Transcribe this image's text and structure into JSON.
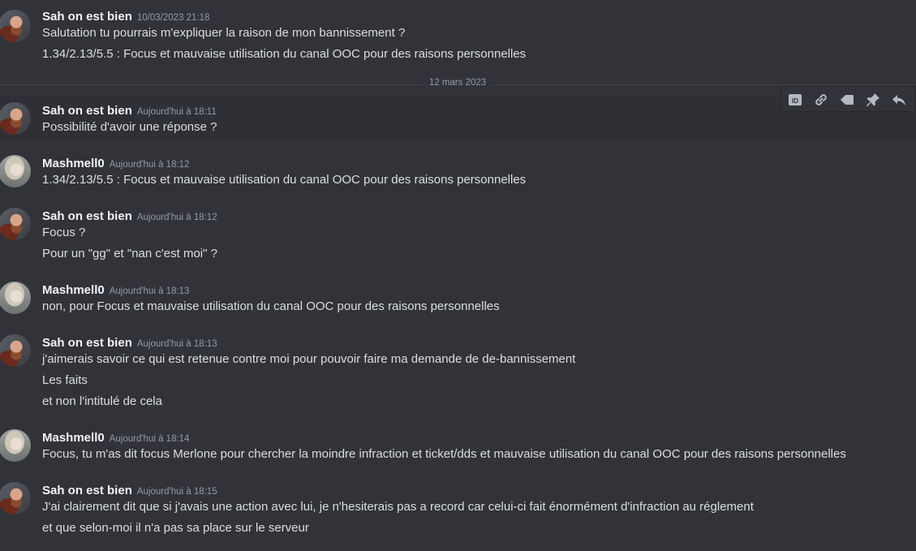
{
  "divider": {
    "date_label": "12 mars 2023"
  },
  "toolbar": {
    "buttons": [
      {
        "icon": "id-icon"
      },
      {
        "icon": "link-icon"
      },
      {
        "icon": "tag-icon"
      },
      {
        "icon": "pin-icon"
      },
      {
        "icon": "reply-icon"
      }
    ]
  },
  "messages": [
    {
      "author": "Sah on est bien",
      "avatar": "sah-avatar",
      "timestamp": "10/03/2023 21:18",
      "lines": [
        "Salutation tu pourrais m'expliquer la raison de mon bannissement ?",
        "1.34/2.13/5.5 : Focus et mauvaise utilisation du canal OOC pour des raisons personnelles"
      ]
    },
    {
      "author": "Sah on est bien",
      "avatar": "sah-avatar",
      "timestamp": "Aujourd'hui à 18:11",
      "lines": [
        "Possibilité d'avoir une réponse ?"
      ]
    },
    {
      "author": "Mashmell0",
      "avatar": "mashmell0-avatar",
      "timestamp": "Aujourd'hui à 18:12",
      "lines": [
        "1.34/2.13/5.5 : Focus et mauvaise utilisation du canal OOC pour des raisons personnelles"
      ]
    },
    {
      "author": "Sah on est bien",
      "avatar": "sah-avatar",
      "timestamp": "Aujourd'hui à 18:12",
      "lines": [
        "Focus ?",
        "Pour un \"gg\" et \"nan c'est moi\" ?"
      ]
    },
    {
      "author": "Mashmell0",
      "avatar": "mashmell0-avatar",
      "timestamp": "Aujourd'hui à 18:13",
      "lines": [
        "non, pour Focus et mauvaise utilisation du canal OOC pour des raisons personnelles"
      ]
    },
    {
      "author": "Sah on est bien",
      "avatar": "sah-avatar",
      "timestamp": "Aujourd'hui à 18:13",
      "lines": [
        "j'aimerais savoir ce qui est retenue contre moi pour pouvoir faire ma demande de de-bannissement",
        "Les faits",
        "et non l'intitulé de cela"
      ]
    },
    {
      "author": "Mashmell0",
      "avatar": "mashmell0-avatar",
      "timestamp": "Aujourd'hui à 18:14",
      "lines": [
        "Focus, tu m'as dit focus Merlone pour chercher la moindre infraction et ticket/dds et mauvaise utilisation du canal OOC pour des raisons personnelles"
      ]
    },
    {
      "author": "Sah on est bien",
      "avatar": "sah-avatar",
      "timestamp": "Aujourd'hui à 18:15",
      "lines": [
        "J'ai clairement dit que si j'avais une action avec lui, je n'hesiterais pas a record car celui-ci fait énormément d'infraction au réglement",
        "et que selon-moi il n'a pas sa place sur le serveur"
      ]
    }
  ]
}
